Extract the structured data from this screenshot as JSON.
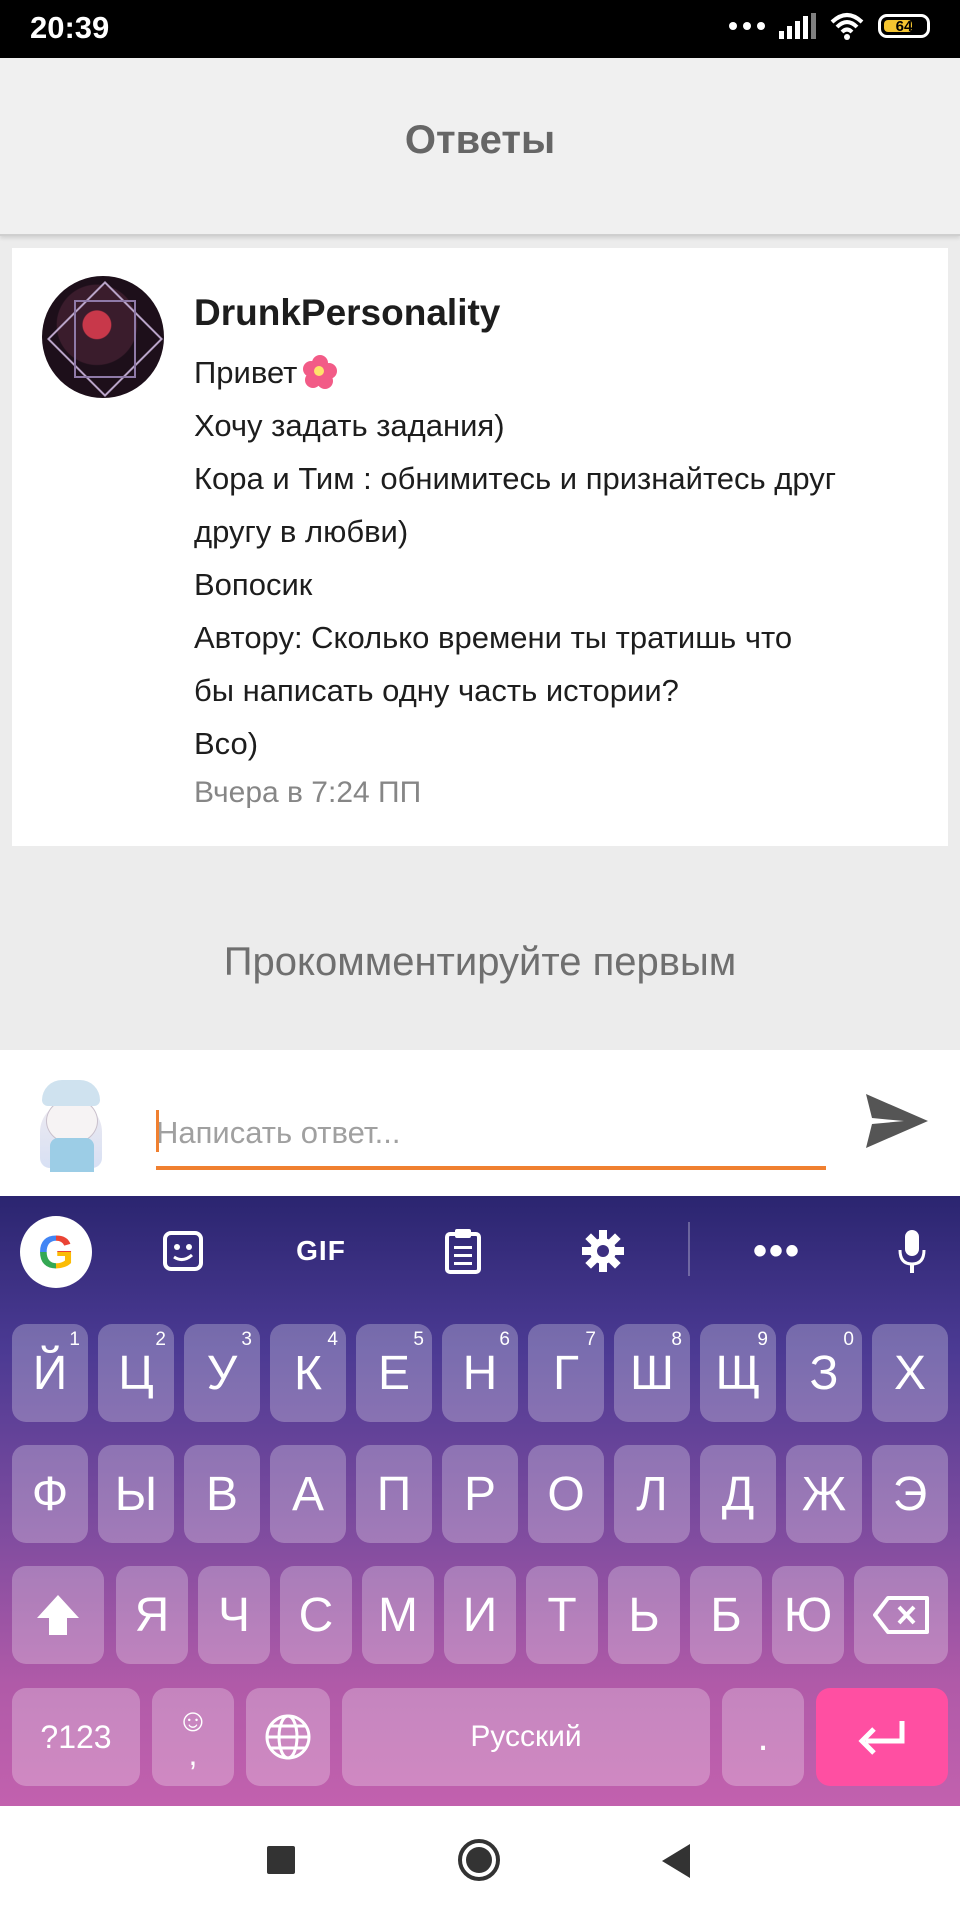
{
  "status_bar": {
    "time": "20:39",
    "battery": "64",
    "icons": [
      "dots-icon",
      "signal-icon",
      "wifi-icon",
      "battery-icon"
    ]
  },
  "header": {
    "title": "Ответы"
  },
  "post": {
    "author": "DrunkPersonality",
    "lines": [
      "Привет",
      "Хочу задать задания)",
      "Кора и Тим : обнимитесь и признайтесь друг",
      "другу в любви)",
      "Вопосик",
      "Автору: Сколько времени ты тратишь что",
      "бы написать одну часть истории?",
      "Всо)"
    ],
    "timestamp": "Вчера в 7:24 ПП"
  },
  "empty_message": "Прокомментируйте первым",
  "reply": {
    "placeholder": "Написать ответ..."
  },
  "keyboard": {
    "toolbar": {
      "gif_label": "GIF",
      "google_label": "G"
    },
    "row1": [
      {
        "label": "Й",
        "hint": "1"
      },
      {
        "label": "Ц",
        "hint": "2"
      },
      {
        "label": "У",
        "hint": "3"
      },
      {
        "label": "К",
        "hint": "4"
      },
      {
        "label": "Е",
        "hint": "5"
      },
      {
        "label": "Н",
        "hint": "6"
      },
      {
        "label": "Г",
        "hint": "7"
      },
      {
        "label": "Ш",
        "hint": "8"
      },
      {
        "label": "Щ",
        "hint": "9"
      },
      {
        "label": "З",
        "hint": "0"
      },
      {
        "label": "Х",
        "hint": ""
      }
    ],
    "row2": [
      "Ф",
      "Ы",
      "В",
      "А",
      "П",
      "Р",
      "О",
      "Л",
      "Д",
      "Ж",
      "Э"
    ],
    "row3": [
      "Я",
      "Ч",
      "С",
      "М",
      "И",
      "Т",
      "Ь",
      "Б",
      "Ю"
    ],
    "row4": {
      "symbols": "?123",
      "comma": ",",
      "space": "Русский",
      "period": "."
    }
  },
  "colors": {
    "accent": "#f08030",
    "enter_key": "#ff4fa2"
  }
}
